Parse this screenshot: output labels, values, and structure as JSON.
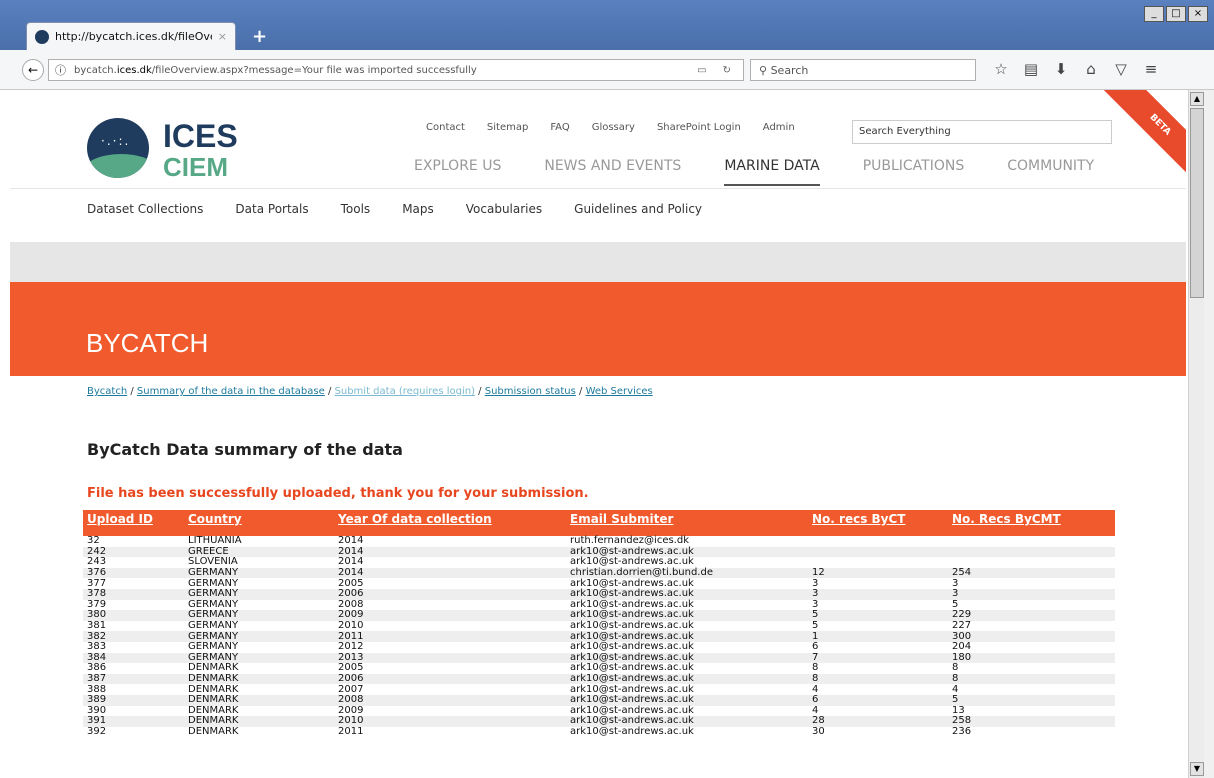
{
  "browser": {
    "tab_title": "http://bycatch.ices.dk/fileOverv",
    "tab_close": "×",
    "new_tab": "+",
    "url_prefix": "bycatch.",
    "url_domain": "ices.dk",
    "url_path": "/fileOverview.aspx?message=Your file was imported successfully",
    "search_placeholder": "Search",
    "window_buttons": [
      "_",
      "□",
      "×"
    ]
  },
  "site": {
    "logo_top": "ICES",
    "logo_bottom": "CIEM",
    "beta": "BETA",
    "top_links": [
      "Contact",
      "Sitemap",
      "FAQ",
      "Glossary",
      "SharePoint Login",
      "Admin"
    ],
    "search_placeholder": "Search Everything",
    "main_nav": [
      "EXPLORE US",
      "NEWS AND EVENTS",
      "MARINE DATA",
      "PUBLICATIONS",
      "COMMUNITY"
    ],
    "sub_nav": [
      "Dataset Collections",
      "Data Portals",
      "Tools",
      "Maps",
      "Vocabularies",
      "Guidelines and Policy"
    ]
  },
  "hero": {
    "title": "BYCATCH"
  },
  "breadcrumbs": [
    "Bycatch",
    "Summary of the data in the database",
    "Submit data (requires login)",
    "Submission status",
    "Web Services"
  ],
  "page": {
    "heading": "ByCatch Data summary of the data",
    "message": "File has been successfully uploaded, thank you for your submission."
  },
  "table": {
    "headers": [
      "Upload ID",
      "Country",
      "Year Of data collection",
      "Email Submiter",
      "No. recs ByCT",
      "No. Recs ByCMT"
    ],
    "rows": [
      [
        "32",
        "LITHUANIA",
        "2014",
        "ruth.fernandez@ices.dk",
        "",
        ""
      ],
      [
        "242",
        "GREECE",
        "2014",
        "ark10@st-andrews.ac.uk",
        "",
        ""
      ],
      [
        "243",
        "SLOVENIA",
        "2014",
        "ark10@st-andrews.ac.uk",
        "",
        ""
      ],
      [
        "376",
        "GERMANY",
        "2014",
        "christian.dorrien@ti.bund.de",
        "12",
        "254"
      ],
      [
        "377",
        "GERMANY",
        "2005",
        "ark10@st-andrews.ac.uk",
        "3",
        "3"
      ],
      [
        "378",
        "GERMANY",
        "2006",
        "ark10@st-andrews.ac.uk",
        "3",
        "3"
      ],
      [
        "379",
        "GERMANY",
        "2008",
        "ark10@st-andrews.ac.uk",
        "3",
        "5"
      ],
      [
        "380",
        "GERMANY",
        "2009",
        "ark10@st-andrews.ac.uk",
        "5",
        "229"
      ],
      [
        "381",
        "GERMANY",
        "2010",
        "ark10@st-andrews.ac.uk",
        "5",
        "227"
      ],
      [
        "382",
        "GERMANY",
        "2011",
        "ark10@st-andrews.ac.uk",
        "1",
        "300"
      ],
      [
        "383",
        "GERMANY",
        "2012",
        "ark10@st-andrews.ac.uk",
        "6",
        "204"
      ],
      [
        "384",
        "GERMANY",
        "2013",
        "ark10@st-andrews.ac.uk",
        "7",
        "180"
      ],
      [
        "386",
        "DENMARK",
        "2005",
        "ark10@st-andrews.ac.uk",
        "8",
        "8"
      ],
      [
        "387",
        "DENMARK",
        "2006",
        "ark10@st-andrews.ac.uk",
        "8",
        "8"
      ],
      [
        "388",
        "DENMARK",
        "2007",
        "ark10@st-andrews.ac.uk",
        "4",
        "4"
      ],
      [
        "389",
        "DENMARK",
        "2008",
        "ark10@st-andrews.ac.uk",
        "6",
        "5"
      ],
      [
        "390",
        "DENMARK",
        "2009",
        "ark10@st-andrews.ac.uk",
        "4",
        "13"
      ],
      [
        "391",
        "DENMARK",
        "2010",
        "ark10@st-andrews.ac.uk",
        "28",
        "258"
      ],
      [
        "392",
        "DENMARK",
        "2011",
        "ark10@st-andrews.ac.uk",
        "30",
        "236"
      ]
    ]
  },
  "colors": {
    "accent": "#f15a2c",
    "brand_navy": "#1f3b5e",
    "brand_green": "#57a887",
    "link": "#1c7a9e"
  },
  "icons": [
    "back-arrow-icon",
    "info-icon",
    "reader-view-icon",
    "reload-icon",
    "search-icon",
    "bookmark-star-icon",
    "library-icon",
    "download-icon",
    "home-icon",
    "pocket-icon",
    "menu-icon"
  ]
}
